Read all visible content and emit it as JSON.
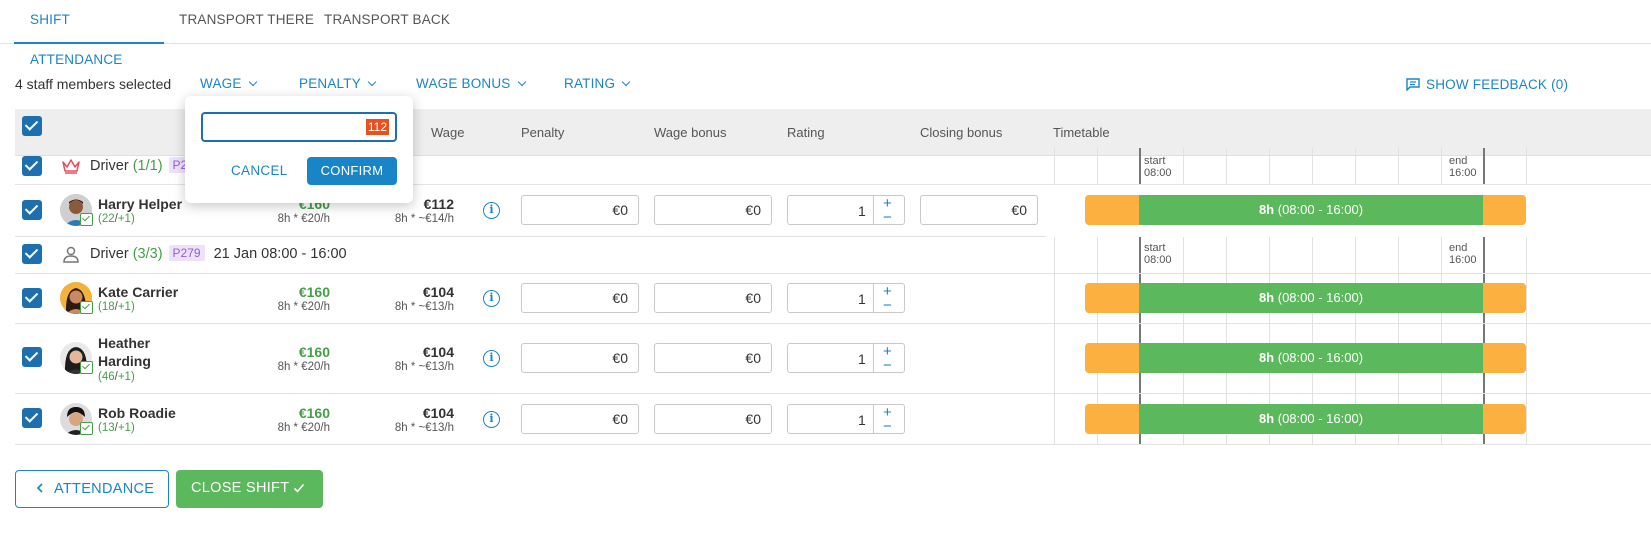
{
  "tabs": [
    {
      "label": "SHIFT ATTENDANCE",
      "active": true
    },
    {
      "label": "TRANSPORT THERE",
      "active": false
    },
    {
      "label": "TRANSPORT BACK",
      "active": false
    }
  ],
  "toolbar": {
    "selected_text": "4 staff members selected",
    "dropdowns": [
      "WAGE",
      "PENALTY",
      "WAGE BONUS",
      "RATING"
    ],
    "feedback_label": "SHOW FEEDBACK (0)"
  },
  "columns": {
    "wage": "Wage",
    "penalty": "Penalty",
    "wage_bonus": "Wage bonus",
    "rating": "Rating",
    "closing_bonus": "Closing bonus",
    "timetable": "Timetable"
  },
  "groups": [
    {
      "role": "Driver",
      "count": "(1/1)",
      "badge": "P2",
      "date": ""
    },
    {
      "role": "Driver",
      "count": "(3/3)",
      "badge": "P279",
      "date": "21 Jan 08:00 - 16:00"
    }
  ],
  "timetable_labels": {
    "start_label": "start",
    "start_time": "08:00",
    "end_label": "end",
    "end_time": "16:00"
  },
  "staff": [
    {
      "name": "Harry Helper",
      "stat_a": "22",
      "stat_b": "+1",
      "base": "€160",
      "base_sub": "8h * €20/h",
      "wage": "€112",
      "wage_sub": "8h * ~€14/h",
      "penalty": "€0",
      "bonus": "€0",
      "rating": "1",
      "closing": "€0",
      "bar": "8h",
      "bar_range": "(08:00 - 16:00)"
    },
    {
      "name": "Kate Carrier",
      "stat_a": "18",
      "stat_b": "+1",
      "base": "€160",
      "base_sub": "8h * €20/h",
      "wage": "€104",
      "wage_sub": "8h * ~€13/h",
      "penalty": "€0",
      "bonus": "€0",
      "rating": "1",
      "bar": "8h",
      "bar_range": "(08:00 - 16:00)"
    },
    {
      "name_line1": "Heather",
      "name_line2": "Harding",
      "stat_a": "46",
      "stat_b": "+1",
      "base": "€160",
      "base_sub": "8h * €20/h",
      "wage": "€104",
      "wage_sub": "8h * ~€13/h",
      "penalty": "€0",
      "bonus": "€0",
      "rating": "1",
      "bar": "8h",
      "bar_range": "(08:00 - 16:00)"
    },
    {
      "name": "Rob Roadie",
      "stat_a": "13",
      "stat_b": "+1",
      "base": "€160",
      "base_sub": "8h * €20/h",
      "wage": "€104",
      "wage_sub": "8h * ~€13/h",
      "penalty": "€0",
      "bonus": "€0",
      "rating": "1",
      "bar": "8h",
      "bar_range": "(08:00 - 16:00)"
    }
  ],
  "popup": {
    "input_value": "112",
    "cancel_label": "CANCEL",
    "confirm_label": "CONFIRM"
  },
  "footer": {
    "attendance_label": "ATTENDANCE",
    "close_shift_label": "CLOSE SHIFT"
  },
  "colors": {
    "accent": "#1a85c6",
    "success": "#5cb85c",
    "warning": "#fbb040",
    "badge": "#9b59d6"
  }
}
